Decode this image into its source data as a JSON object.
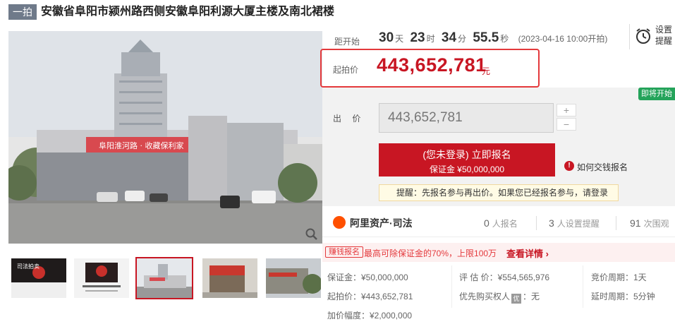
{
  "header": {
    "tag": "一拍",
    "title": "安徽省阜阳市颍州路西侧安徽阜阳利源大厦主楼及南北裙楼"
  },
  "gallery": {
    "main_image": "building-photo",
    "main_sign_text": "阜阳淮河路 · 收藏保利家",
    "thumbnails": [
      {
        "name": "court-notice-1",
        "text1": "司法拍卖",
        "text2": "阜阳市颍州区人民法院 司法拍卖"
      },
      {
        "name": "court-notice-2",
        "text1": "",
        "text2": "阜阳市颍州区人民法院司法拍卖"
      },
      {
        "name": "building-front",
        "selected": true
      },
      {
        "name": "street-shop"
      },
      {
        "name": "building-side"
      }
    ]
  },
  "countdown": {
    "label": "距开始",
    "days": "30",
    "days_unit": "天",
    "hours": "23",
    "hours_unit": "时",
    "minutes": "34",
    "minutes_unit": "分",
    "seconds": "55.5",
    "seconds_unit": "秒",
    "start_time": "(2023-04-16 10:00开拍)"
  },
  "remind": {
    "label_line1": "设置",
    "label_line2": "提醒"
  },
  "start_price": {
    "label": "起拍价",
    "value": "443,652,781",
    "unit": "元"
  },
  "bid": {
    "status_badge": "即将开始",
    "label": "出 价",
    "value": "443,652,781",
    "plus": "+",
    "minus": "−",
    "register_line1": "(您未登录) 立即报名",
    "register_line2": "保证金 ¥50,000,000",
    "help_link": "如何交钱报名",
    "tip": "提醒：先报名参与再出价。如果您已经报名参与，请登录"
  },
  "platform": {
    "name": "阿里资产·司法",
    "signups_count": "0",
    "signups_label": "人报名",
    "reminders_count": "3",
    "reminders_label": "人设置提醒",
    "views_count": "91",
    "views_label": "次围观"
  },
  "promo": {
    "tag": "赚钱报名",
    "text": "最高可除保证金的70%，上限100万",
    "link": "查看详情 ›"
  },
  "details": {
    "deposit": "保证金：¥50,000,000",
    "start_price": "起拍价：¥443,652,781",
    "increment": "加价幅度：¥2,000,000",
    "appraisal": "评 估 价：¥554,565,976",
    "priority_label": "优先购买权人",
    "priority_icon": "优",
    "priority_value": "：无",
    "bid_cycle": "竞价周期：1天",
    "delay_cycle": "延时周期：5分钟"
  },
  "colors": {
    "accent_red": "#c81623",
    "badge_green": "#24a35a",
    "title_tag": "#6f7a8a"
  }
}
